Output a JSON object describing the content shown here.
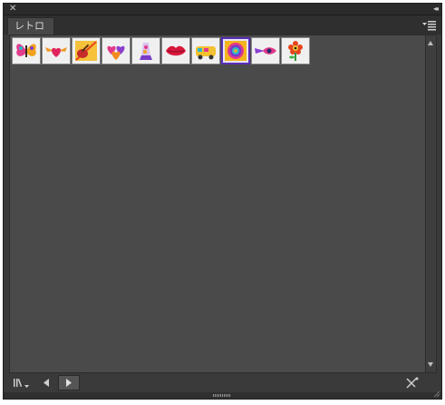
{
  "titlebar": {
    "close_icon_glyph": "✕",
    "collapse_icon_glyph": "◂◂"
  },
  "tabs": [
    {
      "label": "レトロ"
    }
  ],
  "menu": {
    "icon": "panel-menu-icon"
  },
  "swatches": [
    {
      "name": "butterfly",
      "icon": "butterfly-icon"
    },
    {
      "name": "winged-heart",
      "icon": "winged-heart-icon"
    },
    {
      "name": "guitar",
      "icon": "guitar-icon"
    },
    {
      "name": "hearts",
      "icon": "hearts-icon"
    },
    {
      "name": "lava-lamp",
      "icon": "lava-lamp-icon"
    },
    {
      "name": "lips",
      "icon": "lips-icon"
    },
    {
      "name": "van",
      "icon": "van-icon"
    },
    {
      "name": "spiral",
      "icon": "spiral-icon",
      "selected": true
    },
    {
      "name": "winged-eye",
      "icon": "winged-eye-icon"
    },
    {
      "name": "flower",
      "icon": "flower-icon"
    }
  ],
  "bottombar": {
    "library_icon": "library-icon",
    "prev_icon": "prev-arrow-icon",
    "next_icon": "next-arrow-icon",
    "place_icon": "place-symbol-icon"
  },
  "colors": {
    "selected_border": "#5a2fb8",
    "panel_bg": "#4a4a4a"
  }
}
